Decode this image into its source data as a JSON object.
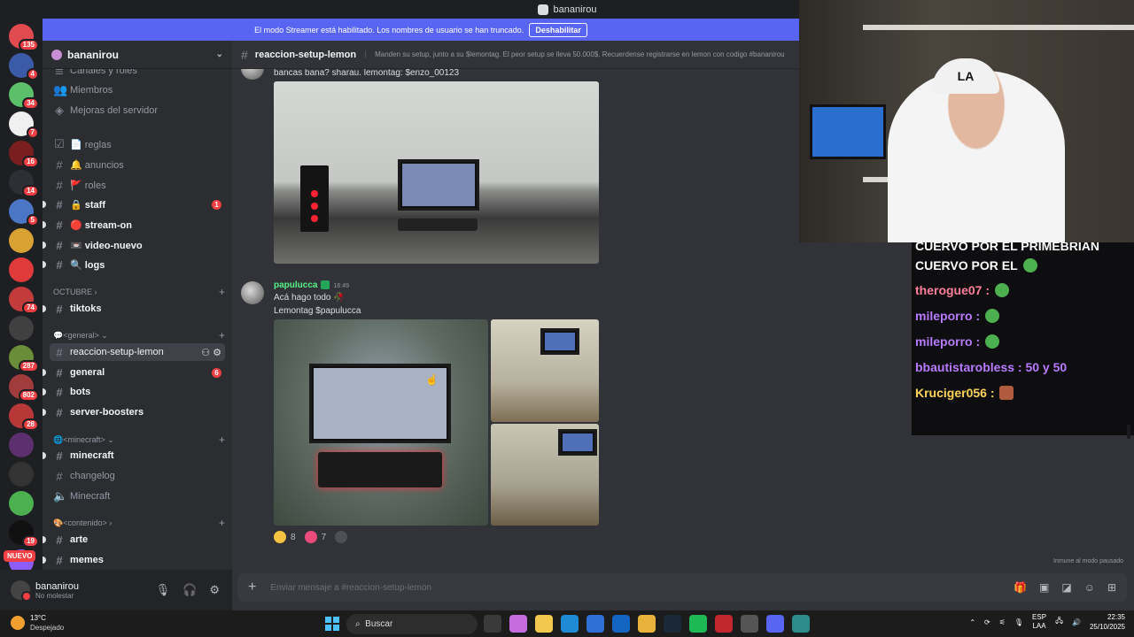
{
  "window": {
    "title": "bananirou"
  },
  "streamer_bar": {
    "text": "El modo Streamer está habilitado. Los nombres de usuario se han truncado.",
    "button": "Deshabilitar"
  },
  "guild": {
    "name": "bananirou"
  },
  "servers": [
    {
      "badge": "135",
      "color": "#e14b50"
    },
    {
      "badge": "4",
      "color": "#3b5ba8"
    },
    {
      "badge": "34",
      "color": "#5cbf6a"
    },
    {
      "badge": "7",
      "color": "#f0f0f0"
    },
    {
      "badge": "16",
      "color": "#7a1f1f"
    },
    {
      "badge": "14",
      "color": "#2d2f35"
    },
    {
      "badge": "5",
      "color": "#4a76c5"
    },
    {
      "badge": "",
      "color": "#d8a132"
    },
    {
      "badge": "",
      "color": "#e03a3a"
    },
    {
      "badge": "74",
      "color": "#c43b3b"
    },
    {
      "badge": "",
      "color": "#404040"
    },
    {
      "badge": "287",
      "color": "#6a8d3a"
    },
    {
      "badge": "802",
      "color": "#a23b3b"
    },
    {
      "badge": "28",
      "color": "#b83838"
    },
    {
      "badge": "",
      "color": "#5e2f6e"
    },
    {
      "badge": "",
      "color": "#333"
    },
    {
      "badge": "",
      "color": "#4caf50"
    },
    {
      "badge": "19",
      "color": "#111"
    },
    {
      "badge": "",
      "color": "#8b5cf6"
    }
  ],
  "nuevo_badge": "NUEVO",
  "sidebar": {
    "top_items": [
      {
        "label": "Canales y roles"
      },
      {
        "label": "Miembros"
      },
      {
        "label": "Mejoras del servidor"
      }
    ],
    "channels_a": [
      {
        "label": "📄 reglas",
        "unread": false
      },
      {
        "label": "🔔 anuncios",
        "unread": false
      },
      {
        "label": "🚩 roles",
        "unread": false
      },
      {
        "label": "🔒 staff",
        "unread": true,
        "mention": "1"
      },
      {
        "label": "🔴 stream-on",
        "unread": true
      },
      {
        "label": "📼 video-nuevo",
        "unread": true
      },
      {
        "label": "🔍 logs",
        "unread": true
      }
    ],
    "category_octubre": "OCTUBRE",
    "channels_b": [
      {
        "label": "tiktoks",
        "unread": true
      }
    ],
    "category_general": "💬<general>",
    "channels_c": [
      {
        "label": "reaccion-setup-lemon",
        "active": true
      },
      {
        "label": "general",
        "unread": true,
        "mention": "6"
      },
      {
        "label": "bots",
        "unread": true
      },
      {
        "label": "server-boosters",
        "unread": true
      }
    ],
    "category_minecraft": "🌐<minecraft>",
    "channels_d": [
      {
        "label": "minecraft",
        "unread": true
      },
      {
        "label": "changelog",
        "unread": false
      },
      {
        "label": "Minecraft",
        "unread": false
      }
    ],
    "category_contenido": "🎨<contenido>",
    "channels_e": [
      {
        "label": "arte",
        "unread": true
      },
      {
        "label": "memes",
        "unread": true
      }
    ]
  },
  "user": {
    "name": "bananirou",
    "status": "No molestar"
  },
  "channel": {
    "name": "reaccion-setup-lemon",
    "topic": "Manden su setup, junto a su $lemontag. El peor setup se lleva 50.000$. Recuerdense registrarse en lemon con codigo #bananirou"
  },
  "messages": [
    {
      "text": "bancas bana? sharau. lemontag: $enzo_00123"
    },
    {
      "author": "papulucca",
      "time": "16:49",
      "line1": "Acá hago todo 🥀",
      "line2": "Lemontag $papulucca"
    }
  ],
  "reactions": [
    {
      "count": "8",
      "color": "#f5c242"
    },
    {
      "count": "7",
      "color": "#e94b7a"
    },
    {
      "count": "",
      "color": "#4e5058"
    }
  ],
  "slowmode": "Inmune al modo pausado",
  "composer": {
    "placeholder": "Enviar mensaje a #reaccion-setup-lemon"
  },
  "webcam": {
    "cap_text": "LA"
  },
  "chat": {
    "lines": [
      {
        "text": "CUERVO POR EL PRIMEBRIAN",
        "color": "#ffffff"
      },
      {
        "text": "CUERVO POR EL",
        "color": "#ffffff"
      },
      {
        "text": "therogue07 :",
        "color": "#ff7f9a"
      },
      {
        "text": "mileporro :",
        "color": "#b87aff"
      },
      {
        "text": "mileporro :",
        "color": "#b87aff"
      },
      {
        "text": "bbautistarobless : 50 y 50",
        "color": "#b87aff"
      },
      {
        "text": "Kruciger056 :",
        "color": "#ffd35a"
      }
    ]
  },
  "taskbar": {
    "weather_temp": "13°C",
    "weather_desc": "Despejado",
    "search": "Buscar",
    "lang1": "ESP",
    "lang2": "LAA",
    "time": "22:35",
    "date": "25/10/2025"
  }
}
